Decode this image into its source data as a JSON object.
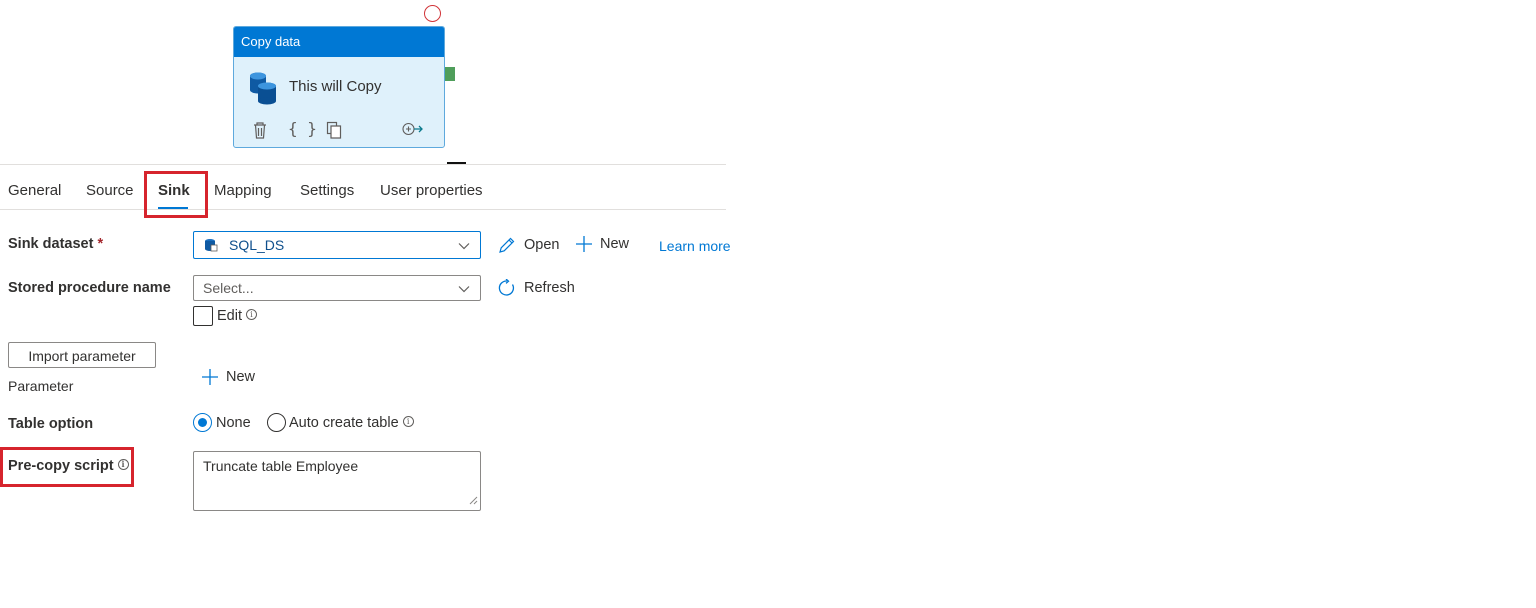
{
  "activity": {
    "type_title": "Copy data",
    "name": "This will Copy"
  },
  "tabs": [
    {
      "label": "General"
    },
    {
      "label": "Source"
    },
    {
      "label": "Sink",
      "active": true
    },
    {
      "label": "Mapping"
    },
    {
      "label": "Settings"
    },
    {
      "label": "User properties"
    }
  ],
  "form": {
    "sink_dataset": {
      "label": "Sink dataset",
      "required_mark": "*",
      "value": "SQL_DS",
      "open_label": "Open",
      "new_label": "New",
      "learn_more": "Learn more"
    },
    "stored_procedure": {
      "label": "Stored procedure name",
      "placeholder": "Select...",
      "refresh_label": "Refresh",
      "edit_label": "Edit"
    },
    "import_parameter_label": "Import parameter",
    "parameter": {
      "label": "Parameter",
      "new_label": "New"
    },
    "table_option": {
      "label": "Table option",
      "options": [
        "None",
        "Auto create table"
      ],
      "selected": "None"
    },
    "pre_copy_script": {
      "label": "Pre-copy script",
      "value": "Truncate table Employee"
    }
  },
  "colors": {
    "accent": "#0078d4",
    "highlight": "#d6242d",
    "activity_bg": "#dff1fb"
  }
}
